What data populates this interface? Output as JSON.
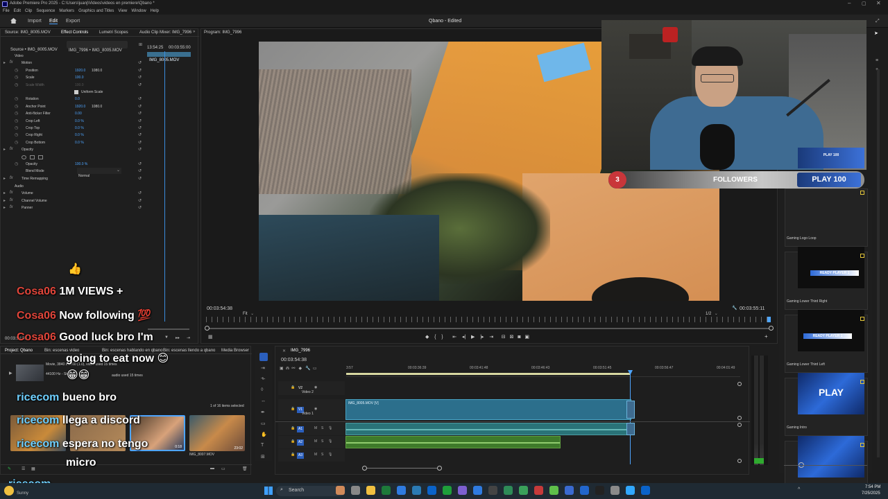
{
  "window": {
    "title": "Adobe Premiere Pro 2025 - C:\\Users\\juanj\\Videos\\videos en premiere\\Qbano *"
  },
  "menubar": [
    "File",
    "Edit",
    "Clip",
    "Sequence",
    "Markers",
    "Graphics and Titles",
    "View",
    "Window",
    "Help"
  ],
  "header": {
    "tabs": [
      "Import",
      "Edit",
      "Export"
    ],
    "project_title": "Qbano - Edited"
  },
  "source_panel": {
    "tabs": [
      "Source: IMG_8005.MOV",
      "Effect Controls",
      "Lumetri Scopes",
      "Audio Clip Mixer: IMG_7996"
    ],
    "source_select": "Source • IMG_8005.MOV",
    "clip_select": "IMG_7996 • IMG_8005.MOV",
    "timecode_a": "13:54:25",
    "timecode_b": "00:03:55:00",
    "clip_label": "IMG_8005.MOV"
  },
  "effects": [
    {
      "label": "Video",
      "kind": "section"
    },
    {
      "label": "Motion",
      "kind": "fx"
    },
    {
      "label": "Position",
      "kind": "prop",
      "v1": "1920.0",
      "v2": "1080.0"
    },
    {
      "label": "Scale",
      "kind": "prop",
      "v1": "100.0",
      "v2": ""
    },
    {
      "label": "Scale Width",
      "kind": "prop-dim",
      "v1": "100.0",
      "v2": ""
    },
    {
      "label": "",
      "kind": "check",
      "v1": "Uniform Scale",
      "v2": ""
    },
    {
      "label": "Rotation",
      "kind": "prop",
      "v1": "0.0",
      "v2": ""
    },
    {
      "label": "Anchor Point",
      "kind": "prop",
      "v1": "1920.0",
      "v2": "1080.0"
    },
    {
      "label": "Anti-flicker Filter",
      "kind": "prop",
      "v1": "0.00",
      "v2": ""
    },
    {
      "label": "Crop Left",
      "kind": "prop",
      "v1": "0.0 %",
      "v2": ""
    },
    {
      "label": "Crop Top",
      "kind": "prop",
      "v1": "0.0 %",
      "v2": ""
    },
    {
      "label": "Crop Right",
      "kind": "prop",
      "v1": "0.0 %",
      "v2": ""
    },
    {
      "label": "Crop Bottom",
      "kind": "prop",
      "v1": "0.0 %",
      "v2": ""
    },
    {
      "label": "Opacity",
      "kind": "fx"
    },
    {
      "label": "",
      "kind": "masks",
      "v1": "",
      "v2": ""
    },
    {
      "label": "Opacity",
      "kind": "prop",
      "v1": "100.0 %",
      "v2": ""
    },
    {
      "label": "Blend Mode",
      "kind": "select",
      "v1": "Normal",
      "v2": ""
    },
    {
      "label": "Time Remapping",
      "kind": "fx"
    },
    {
      "label": "Audio",
      "kind": "section"
    },
    {
      "label": "Volume",
      "kind": "fx"
    },
    {
      "label": "Channel Volume",
      "kind": "fx"
    },
    {
      "label": "Panner",
      "kind": "fx"
    }
  ],
  "effects_footer": {
    "timecode": "00:03:54:38"
  },
  "program": {
    "title": "Program: IMG_7996",
    "timecode": "00:03:54:38",
    "fit": "Fit",
    "quality": "1/2",
    "duration": "00:03:55:11"
  },
  "stream_overlay": {
    "follower_count": "3",
    "followers_label": "FOLLOWERS",
    "badge_text": "PLAY 100"
  },
  "chat": [
    {
      "user": "",
      "msg": "👍",
      "user_color": "red"
    },
    {
      "user": "Cosa06",
      "msg": "1M VIEWS +",
      "user_color": "red"
    },
    {
      "user": "Cosa06",
      "msg": "Now following 💯",
      "user_color": "red"
    },
    {
      "user": "Cosa06",
      "msg": "Good luck bro I'm",
      "user_color": "red"
    },
    {
      "user": "",
      "msg": "going to eat now 😊",
      "user_color": "red"
    },
    {
      "user": "",
      "msg": "😁😁",
      "user_color": "red"
    },
    {
      "user": "ricecom",
      "msg": "bueno bro",
      "user_color": "blue"
    },
    {
      "user": "ricecom",
      "msg": "llega a discord",
      "user_color": "blue"
    },
    {
      "user": "ricecom",
      "msg": "espera no tengo",
      "user_color": "blue"
    },
    {
      "user": "",
      "msg": "micro",
      "user_color": "blue"
    },
    {
      "user": "ricecom",
      "msg": "",
      "user_color": "blue"
    }
  ],
  "project_panel": {
    "tabs": [
      "Project: Qbano",
      "Bin: escenas video",
      "Bin: escenas hablando en qbano",
      "Bin: escenas llendo a qbano",
      "Media Browser"
    ],
    "info": "Movie, 3840 x 2160 (1.0), video used 15 times",
    "audio_info": "44100 Hz - Stereo",
    "audio_used": "audio used 15 times",
    "items_selected": "1 of 16 items selected",
    "thumbs": [
      {
        "name": "",
        "dur": ""
      },
      {
        "name": "",
        "dur": ""
      },
      {
        "name": "",
        "dur": "0:18"
      },
      {
        "name": "IMG_8007.MOV",
        "dur": "23:02"
      }
    ]
  },
  "timeline": {
    "tab": "IMG_7996",
    "timecode": "00:03:54:38",
    "ruler": [
      "3:57",
      "00:03:36:39",
      "00:03:41:48",
      "00:03:46:43",
      "00:03:51:45",
      "00:03:56:47",
      "00:04:01:49"
    ],
    "tracks": [
      "V2",
      "V1",
      "A1",
      "A2",
      "A3"
    ],
    "track_names": {
      "v2": "Video 2",
      "v1": "Video 1"
    },
    "clip_label": "IMG_8005.MOV [V]"
  },
  "essential_graphics": {
    "items": [
      "Gaming Logo Loop",
      "Gaming Lower Third Right",
      "Gaming Lower Third Left",
      "Gaming Intro",
      ""
    ],
    "thumb_text": [
      "PLAY 100",
      "READY PLAYER 1",
      "READY PLAYER 1",
      "PLAY",
      ""
    ]
  },
  "taskbar": {
    "search_placeholder": "Search",
    "time": "7:54 PM",
    "date": "7/25/2025",
    "user": "Sunny"
  }
}
